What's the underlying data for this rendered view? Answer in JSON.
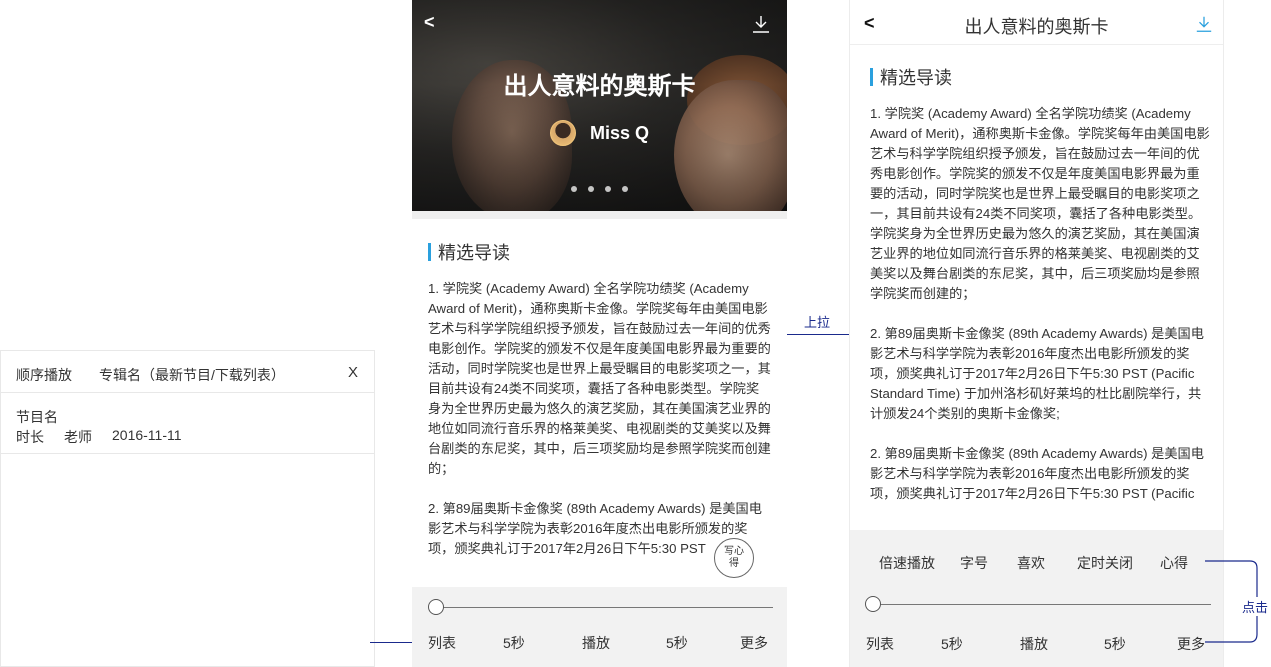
{
  "colors": {
    "accent": "#2aa0de",
    "annotation": "#1a2a8c",
    "player_bg": "#f2f2f2"
  },
  "playlist": {
    "mode_label": "顺序播放",
    "album_label": "专辑名（最新节目/下载列表）",
    "close_label": "X",
    "items": [
      {
        "name": "节目名",
        "duration": "时长",
        "teacher": "老师",
        "date": "2016-11-11"
      }
    ]
  },
  "detail": {
    "title": "出人意料的奥斯卡",
    "author": "Miss Q",
    "back_label": "<",
    "download_icon": "download-icon",
    "carousel_dots": 4,
    "section_title": "精选导读",
    "paragraphs": [
      "1. 学院奖 (Academy Award) 全名学院功绩奖 (Academy Award of Merit)，通称奥斯卡金像。学院奖每年由美国电影艺术与科学学院组织授予颁发，旨在鼓励过去一年间的优秀电影创作。学院奖的颁发不仅是年度美国电影界最为重要的活动，同时学院奖也是世界上最受瞩目的电影奖项之一，其目前共设有24类不同奖项，囊括了各种电影类型。学院奖身为全世界历史最为悠久的演艺奖励，其在美国演艺业界的地位如同流行音乐界的格莱美奖、电视剧类的艾美奖以及舞台剧类的东尼奖，其中，后三项奖励均是参照学院奖而创建的；",
      "2. 第89届奥斯卡金像奖 (89th Academy Awards) 是美国电影艺术与科学学院为表彰2016年度杰出电影所颁发的奖项，颁奖典礼订于2017年2月26日下午5:30 PST (Pacific Standard Time) 于加州洛杉矶好莱坞的杜比剧院举行，共计颁发24个类别的奥斯卡金像奖;",
      "2. 第89届奥斯卡金像奖 (89th Academy Awards) 是美国电影艺术与科学学院为表彰2016年度杰出电影所颁发的奖项，颁奖典礼订于2017年2月26日下午5:30 PST (Pacific"
    ],
    "paragraphs_a": [
      "1. 学院奖 (Academy Award) 全名学院功绩奖 (Academy Award of Merit)，通称奥斯卡金像。学院奖每年由美国电影艺术与科学学院组织授予颁发，旨在鼓励过去一年间的优秀电影创作。学院奖的颁发不仅是年度美国电影界最为重要的活动，同时学院奖也是世界上最受瞩目的电影奖项之一，其目前共设有24类不同奖项，囊括了各种电影类型。学院奖身为全世界历史最为悠久的演艺奖励，其在美国演艺业界的地位如同流行音乐界的格莱美奖、电视剧类的艾美奖以及舞台剧类的东尼奖，其中，后三项奖励均是参照学院奖而创建的；",
      "2. 第89届奥斯卡金像奖 (89th Academy Awards) 是美国电影艺术与科学学院为表彰2016年度杰出电影所颁发的奖项，颁奖典礼订于2017年2月26日下午5:30 PST"
    ],
    "note_button": "写心得",
    "progress": 0
  },
  "controls": {
    "list": "列表",
    "rewind": "5秒",
    "play": "播放",
    "forward": "5秒",
    "more": "更多"
  },
  "more_menu": {
    "speed": "倍速播放",
    "font_size": "字号",
    "like": "喜欢",
    "timer": "定时关闭",
    "notes": "心得"
  },
  "annotations": {
    "pull_up": "上拉",
    "click": "点击"
  }
}
